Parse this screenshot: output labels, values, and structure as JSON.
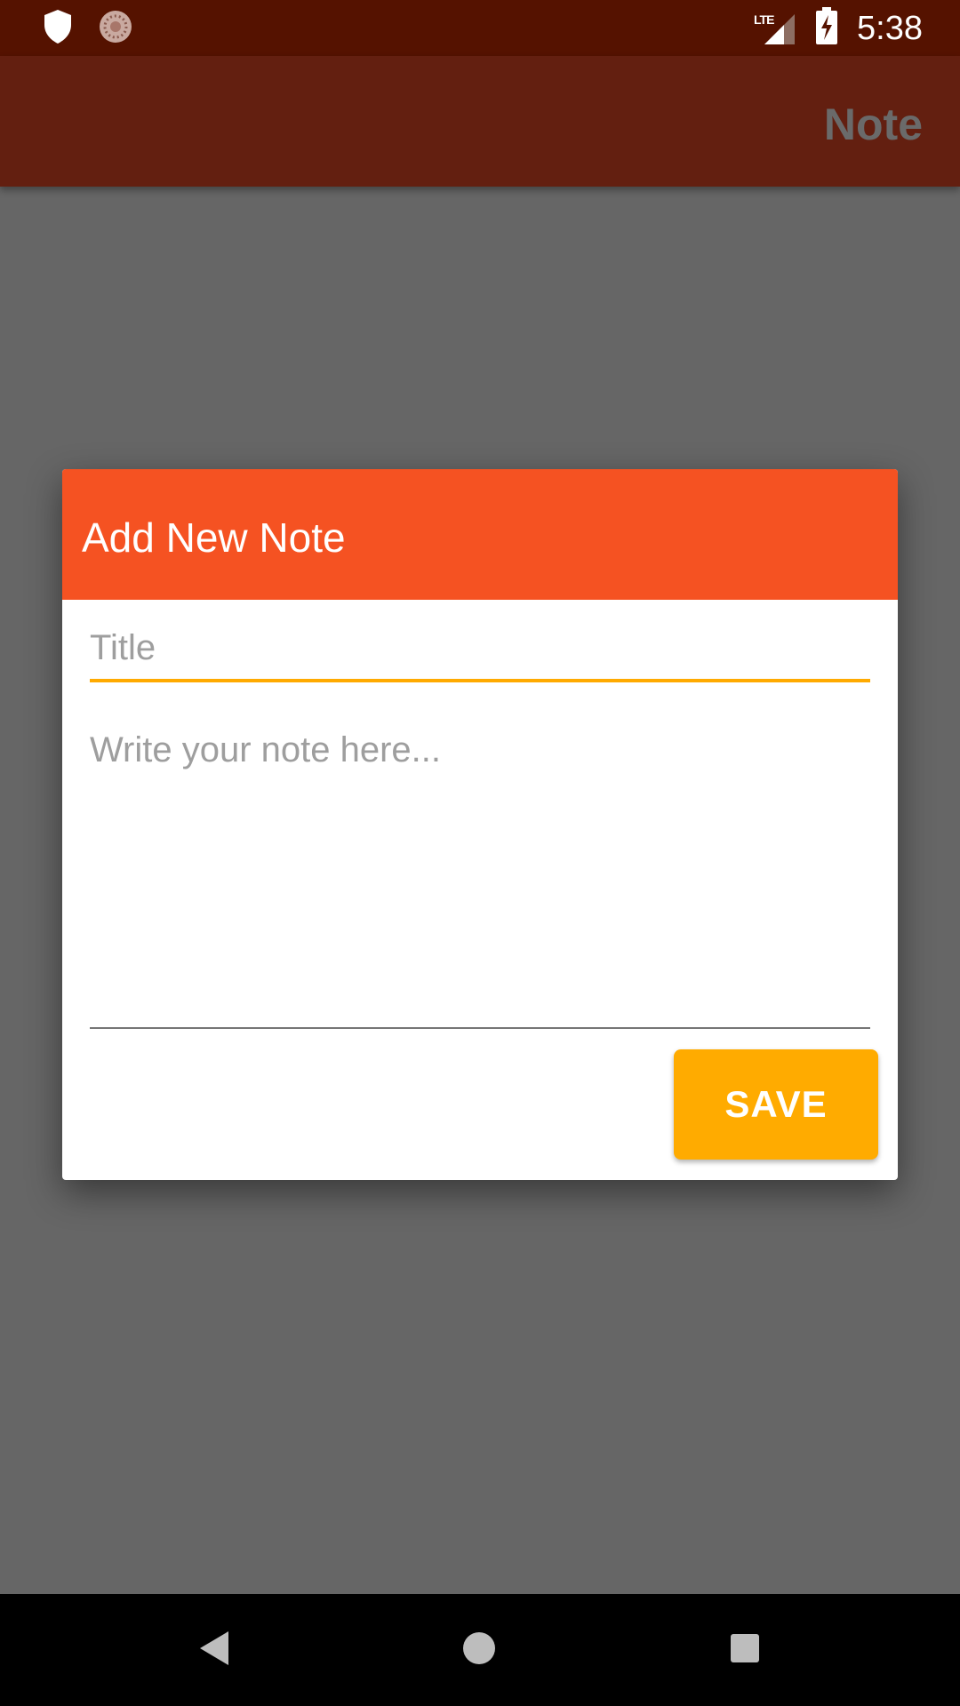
{
  "status_bar": {
    "time": "5:38",
    "network_label": "LTE",
    "icons": [
      "shield-icon",
      "sync-icon",
      "lte-signal-icon",
      "battery-charging-icon"
    ]
  },
  "app_bar": {
    "title": "Note"
  },
  "dialog": {
    "title": "Add New Note",
    "title_field": {
      "value": "",
      "placeholder": "Title"
    },
    "body_field": {
      "value": "",
      "placeholder": "Write your note here..."
    },
    "save_label": "SAVE"
  },
  "nav_bar": {
    "buttons": [
      "back-icon",
      "home-icon",
      "recents-icon"
    ]
  },
  "colors": {
    "status_bar": "#551200",
    "app_bar": "#631f10",
    "scrim_background": "#666666",
    "dialog_header": "#f55222",
    "accent": "#ffab00",
    "nav_bar": "#000000"
  }
}
